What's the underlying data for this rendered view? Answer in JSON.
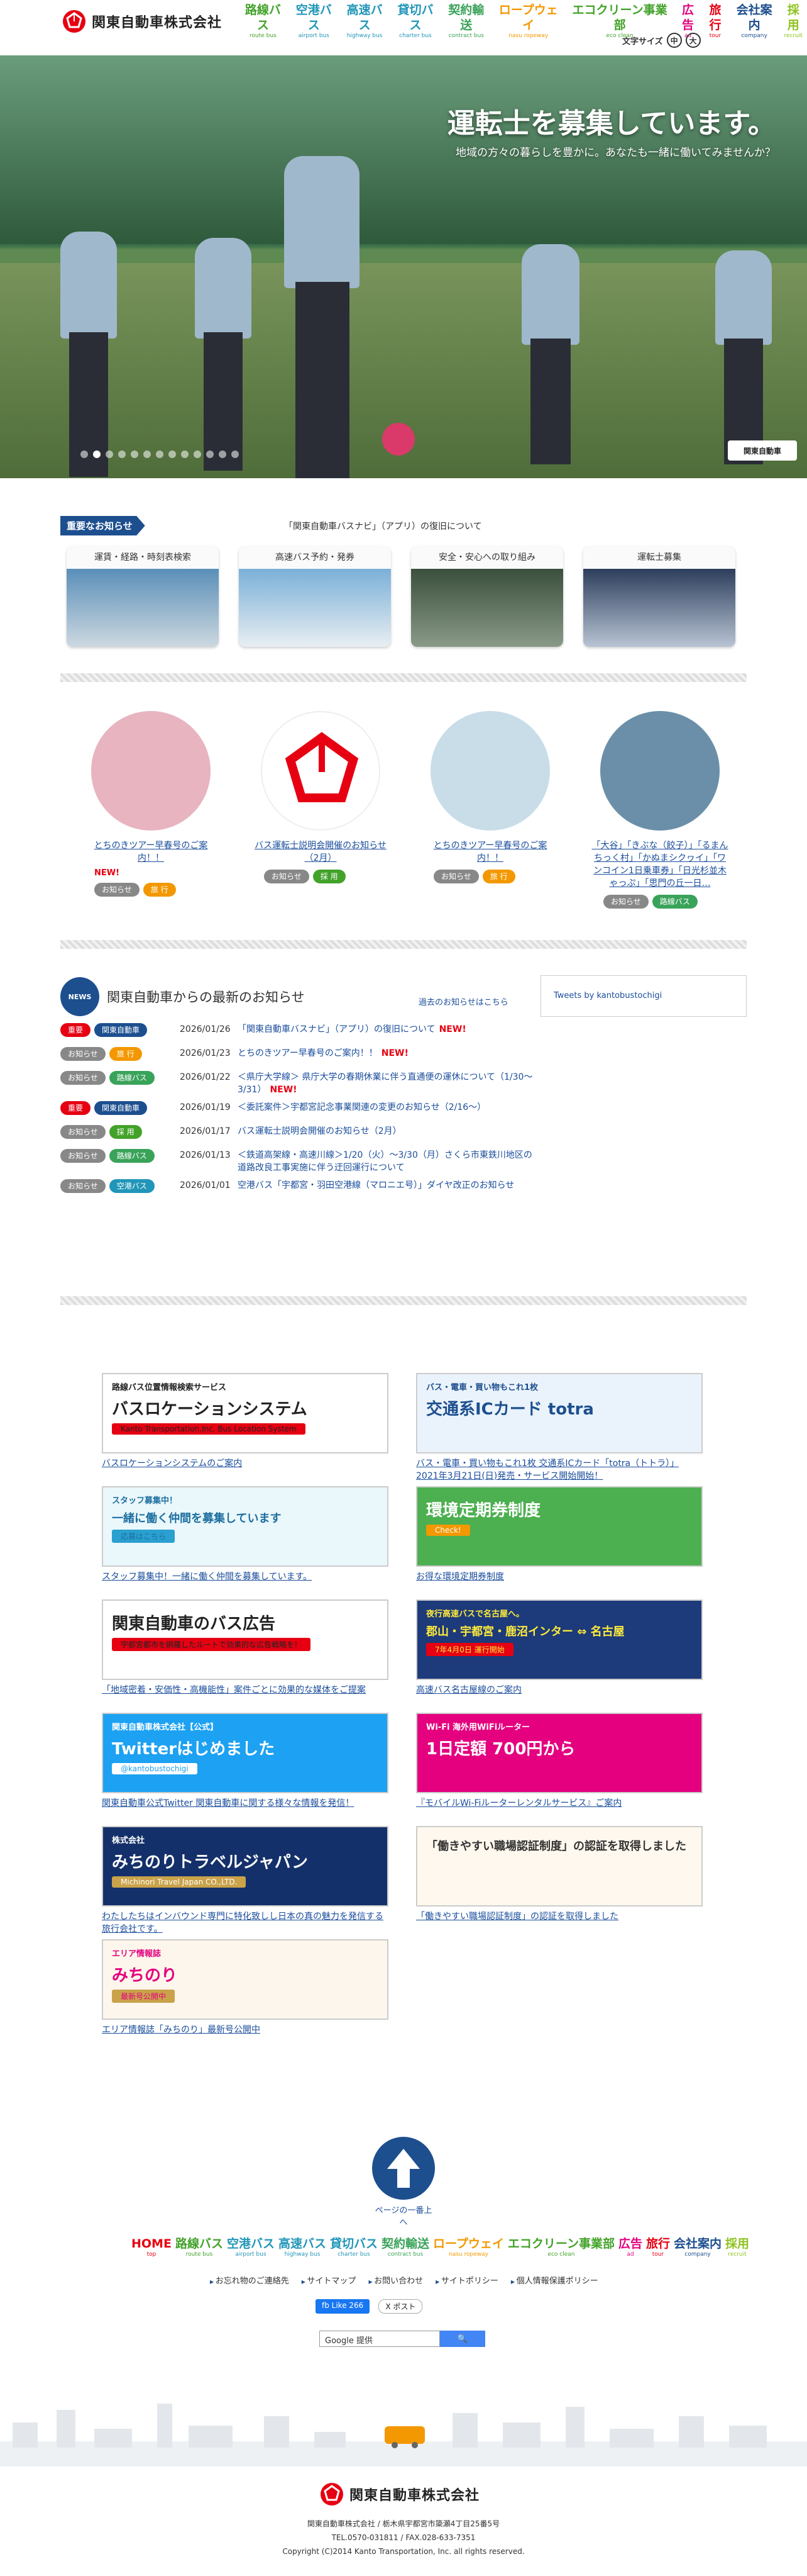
{
  "header": {
    "company": "関東自動車株式会社",
    "nav": [
      {
        "jp": "路線バス",
        "en": "route bus",
        "color": "#43a22a"
      },
      {
        "jp": "空港バス",
        "en": "airport bus",
        "color": "#2196b8"
      },
      {
        "jp": "高速バス",
        "en": "highway bus",
        "color": "#2196b8"
      },
      {
        "jp": "貸切バス",
        "en": "charter bus",
        "color": "#2196b8"
      },
      {
        "jp": "契約輸送",
        "en": "contract bus",
        "color": "#3aa35a"
      },
      {
        "jp": "ロープウェイ",
        "en": "nasu ropeway",
        "color": "#f39800"
      },
      {
        "jp": "エコクリーン事業部",
        "en": "eco clean",
        "color": "#43a22a"
      },
      {
        "jp": "広告",
        "en": "ad",
        "color": "#e4007f"
      },
      {
        "jp": "旅行",
        "en": "tour",
        "color": "#e60012"
      },
      {
        "jp": "会社案内",
        "en": "company",
        "color": "#1d4f8f"
      },
      {
        "jp": "採用",
        "en": "recruit",
        "color": "#8fc31f"
      }
    ],
    "font_size_label": "文字サイズ",
    "font_size_mid": "中",
    "font_size_large": "大"
  },
  "hero": {
    "title": "運転士を募集しています。",
    "subtitle": "地域の方々の暮らしを豊かに。あなたも一緒に働いてみませんか？",
    "badge": "関東自動車",
    "dots": 13,
    "active_dot": 1
  },
  "important": {
    "label": "重要なお知らせ",
    "text": "「関東自動車バスナビ」（アプリ）の復旧について"
  },
  "cards": [
    {
      "label": "運賃・経路・時刻表検索"
    },
    {
      "label": "高速バス予約・発券"
    },
    {
      "label": "安全・安心への取り組み"
    },
    {
      "label": "運転士募集"
    }
  ],
  "pickups": [
    {
      "title": "とちのきツアー早春号のご案内！！",
      "new": "NEW!",
      "tags": [
        "お知らせ",
        "旅 行"
      ]
    },
    {
      "title": "バス運転士説明会開催のお知らせ（2月）",
      "new": "",
      "tags": [
        "お知らせ",
        "採 用"
      ]
    },
    {
      "title": "とちのきツアー早春号のご案内！！",
      "new": "",
      "tags": [
        "お知らせ",
        "旅 行"
      ]
    },
    {
      "title": "「大谷」「きぶな（餃子）」「るまんちっく村」「かぬまシクヮイ」「ワンコイン1日乗車券」「日光杉並木ゃっぷ」「思門の丘一日…",
      "new": "",
      "tags": [
        "お知らせ",
        "路線バス"
      ]
    }
  ],
  "news": {
    "icon": "NEWS",
    "title": "関東自動車からの最新のお知らせ",
    "more": "過去のお知らせはこちら",
    "items": [
      {
        "tags": [
          "重要",
          "関東自動車"
        ],
        "date": "2026/01/26",
        "title": "「関東自動車バスナビ」（アプリ）の復旧について",
        "new": "NEW!"
      },
      {
        "tags": [
          "お知らせ",
          "旅 行"
        ],
        "date": "2026/01/23",
        "title": "とちのきツアー早春号のご案内！！",
        "new": "NEW!"
      },
      {
        "tags": [
          "お知らせ",
          "路線バス"
        ],
        "date": "2026/01/22",
        "title": "＜県庁大学線＞ 県庁大学の春期休業に伴う直通便の運休について（1/30～3/31）",
        "new": "NEW!"
      },
      {
        "tags": [
          "重要",
          "関東自動車"
        ],
        "date": "2026/01/19",
        "title": "＜委託案件＞宇都宮記念事業関連の変更のお知らせ（2/16～）",
        "new": ""
      },
      {
        "tags": [
          "お知らせ",
          "採 用"
        ],
        "date": "2026/01/17",
        "title": "バス運転士説明会開催のお知らせ（2月）",
        "new": ""
      },
      {
        "tags": [
          "お知らせ",
          "路線バス"
        ],
        "date": "2026/01/13",
        "title": "＜鉄道高架線・高速川線＞1/20（火）～3/30（月）さくら市東鉄川地区の道路改良工事実施に伴う迂回運行について",
        "new": ""
      },
      {
        "tags": [
          "お知らせ",
          "空港バス"
        ],
        "date": "2026/01/01",
        "title": "空港バス「宇都宮・羽田空港線（マロニエ号）」ダイヤ改正のお知らせ",
        "new": ""
      }
    ]
  },
  "twitter": {
    "label": "Tweets by kantobustochigi"
  },
  "banners": [
    {
      "heading": "路線バス位置情報検索サービス",
      "main": "バスロケーションシステム",
      "sub": "Kanto Transportation,Inc. Bus Location System",
      "caption": "バスロケーションシステムのご案内"
    },
    {
      "heading": "バス・電車・買い物もこれ1枚",
      "main": "交通系ICカード totra",
      "sub": "",
      "caption": "バス・電車・買い物もこれ1枚 交通系ICカード「totra（トトラ）」 2021年3月21日(日)発売・サービス開始開始！"
    },
    {
      "heading": "スタッフ募集中！",
      "main": "一緒に働く仲間を募集しています",
      "sub": "応募はこちら",
      "caption": "スタッフ募集中！一緒に働く仲間を募集しています。"
    },
    {
      "heading": "",
      "main": "環境定期券制度",
      "sub": "Check!",
      "caption": "お得な環境定期券制度"
    },
    {
      "heading": "",
      "main": "関東自動車のバス広告",
      "sub": "宇都宮都市を網羅したルートで効果的な広告戦略を！",
      "caption": "「地域密着・安価性・高機能性」案件ごとに効果的な媒体をご提案"
    },
    {
      "heading": "夜行高速バスで名古屋へ。",
      "main": "郡山・宇都宮・鹿沼インター ⇔ 名古屋",
      "sub": "7年4月0日 運行開始",
      "caption": "高速バス名古屋線のご案内"
    },
    {
      "heading": "関東自動車株式会社【公式】",
      "main": "Twitterはじめました",
      "sub": "@kantobustochigi",
      "caption": "関東自動車公式Twitter 関東自動車に関する様々な情報を発信！"
    },
    {
      "heading": "Wi-Fi 海外用WiFiルーター",
      "main": "1日定額 700円から",
      "sub": "",
      "caption": "『モバイルWi-Fiルーターレンタルサービス』ご案内"
    },
    {
      "heading": "株式会社",
      "main": "みちのりトラベルジャパン",
      "sub": "Michinori Travel Japan CO.,LTD.",
      "caption": "わたしたちはインバウンド専門に特化致しし日本の真の魅力を発信する旅行会社です。"
    },
    {
      "heading": "",
      "main": "「働きやすい職場認証制度」の認証を取得しました",
      "sub": "",
      "caption": "「働きやすい職場認証制度」の認証を取得しました"
    },
    {
      "heading": "エリア情報誌",
      "main": "みちのり",
      "sub": "最新号公開中",
      "caption": "エリア情報誌「みちのり」最新号公開中"
    }
  ],
  "pagetop": "ページの一番上へ",
  "footer_nav": [
    {
      "jp": "HOME",
      "en": "top",
      "color": "#e60012"
    },
    {
      "jp": "路線バス",
      "en": "route bus",
      "color": "#43a22a"
    },
    {
      "jp": "空港バス",
      "en": "airport bus",
      "color": "#2196b8"
    },
    {
      "jp": "高速バス",
      "en": "highway bus",
      "color": "#2196b8"
    },
    {
      "jp": "貸切バス",
      "en": "charter bus",
      "color": "#2196b8"
    },
    {
      "jp": "契約輸送",
      "en": "contract bus",
      "color": "#3aa35a"
    },
    {
      "jp": "ロープウェイ",
      "en": "nasu ropeway",
      "color": "#f39800"
    },
    {
      "jp": "エコクリーン事業部",
      "en": "eco clean",
      "color": "#43a22a"
    },
    {
      "jp": "広告",
      "en": "ad",
      "color": "#e4007f"
    },
    {
      "jp": "旅行",
      "en": "tour",
      "color": "#e60012"
    },
    {
      "jp": "会社案内",
      "en": "company",
      "color": "#1d4f8f"
    },
    {
      "jp": "採用",
      "en": "recruit",
      "color": "#8fc31f"
    }
  ],
  "footer_links": [
    "お忘れ物のご連絡先",
    "サイトマップ",
    "お問い合わせ",
    "サイトポリシー",
    "個人情報保護ポリシー"
  ],
  "social": {
    "fb": "fb Like 266",
    "x": "X ポスト"
  },
  "search": {
    "placeholder": "Google 提供",
    "button": "🔍"
  },
  "footer": {
    "company": "関東自動車株式会社",
    "address": "関東自動車株式会社 / 栃木県宇都宮市簗瀬4丁目25番5号",
    "tel": "TEL.0570-031811 / FAX.028-633-7351",
    "copyright": "Copyright (C)2014 Kanto Transportation, Inc. all rights reserved."
  }
}
